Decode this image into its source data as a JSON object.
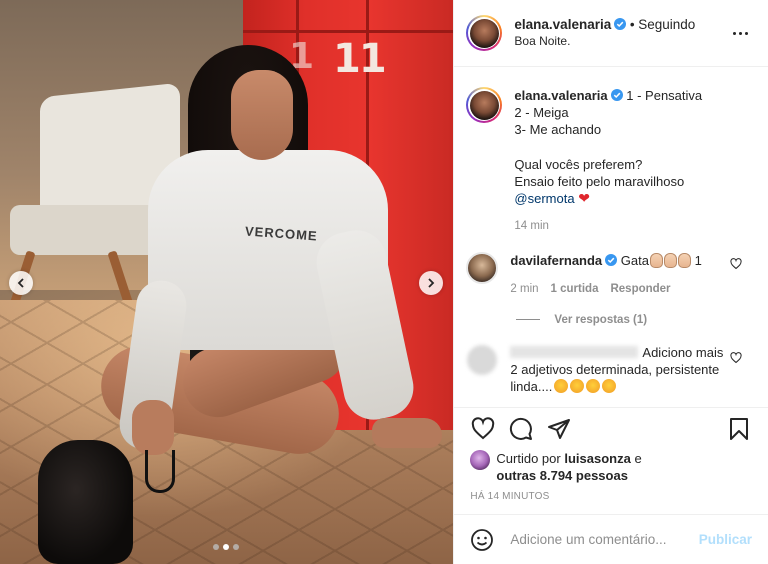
{
  "header": {
    "username": "elana.valenaria",
    "separator": "•",
    "follow_status": "Seguindo",
    "location": "Boa Noite."
  },
  "photo": {
    "locker_number": "11",
    "hoodie_print": "VERCOME",
    "carousel_dots": 3,
    "active_dot": 2
  },
  "caption": {
    "username": "elana.valenaria",
    "lines": [
      "1 - Pensativa",
      "2 - Meiga",
      "3- Me achando",
      "",
      "Qual vocês preferem?",
      "Ensaio feito pelo maravilhoso"
    ],
    "mention": "@sermota",
    "heart": "❤",
    "time": "14 min"
  },
  "comments": [
    {
      "username": "davilafernanda",
      "text": "Gata",
      "count": "1",
      "time": "2 min",
      "likes": "1 curtida",
      "reply": "Responder",
      "view_replies": "Ver respostas (1)"
    },
    {
      "text": "Adiciono mais 2 adjetivos determinada, persistente linda...."
    }
  ],
  "likes": {
    "prefix": "Curtido por",
    "user": "luisasonza",
    "conjunction": "e",
    "others": "outras 8.794 pessoas"
  },
  "post_time": "HÁ 14 MINUTOS",
  "add_comment": {
    "placeholder": "Adicione um comentário...",
    "publish": "Publicar"
  },
  "colors": {
    "verified": "#3897f0",
    "link": "#00376b",
    "publish_disabled": "#b2dffc",
    "locker_red": "#e0302a"
  }
}
